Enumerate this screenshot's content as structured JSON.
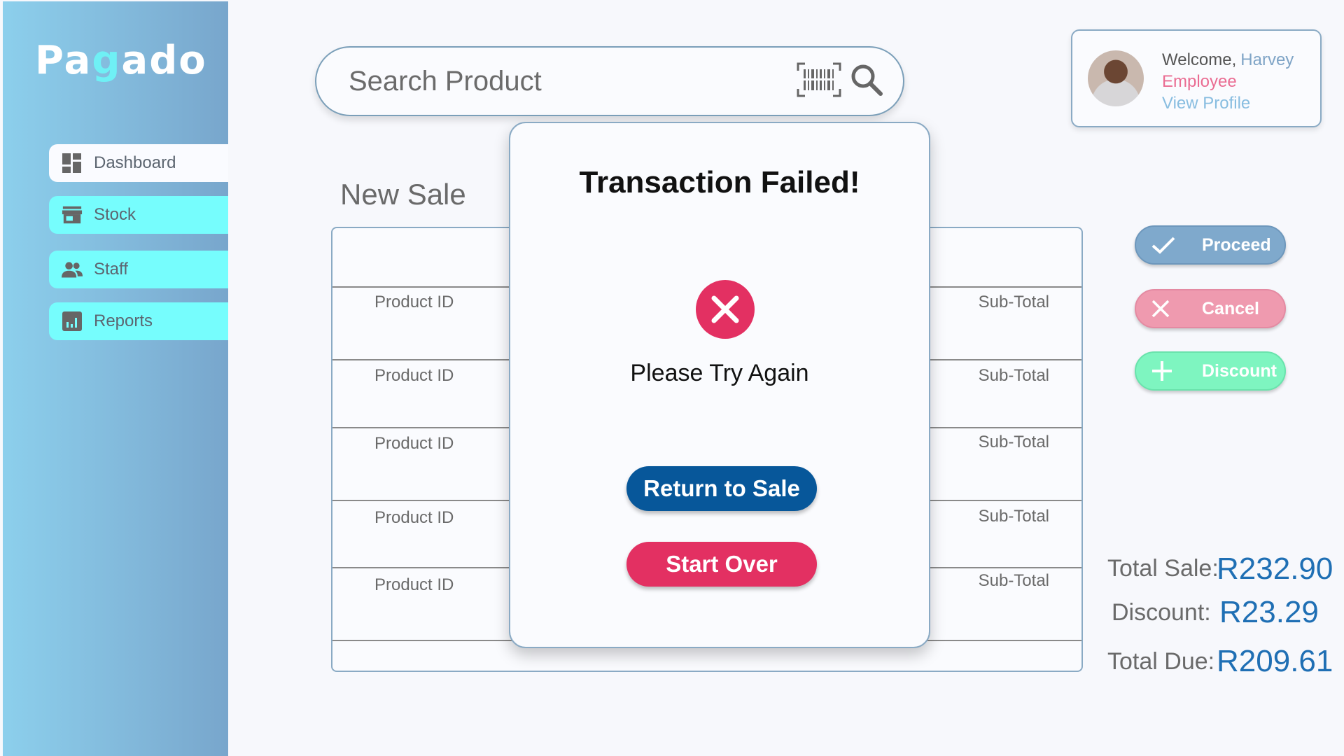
{
  "app": {
    "logo_pre": "Pa",
    "logo_g": "g",
    "logo_post": "ado"
  },
  "sidebar": {
    "items": [
      {
        "label": "Dashboard",
        "icon": "dashboard-icon"
      },
      {
        "label": "Stock",
        "icon": "store-icon"
      },
      {
        "label": "Staff",
        "icon": "people-icon"
      },
      {
        "label": "Reports",
        "icon": "bar-chart-icon"
      }
    ]
  },
  "search": {
    "placeholder": "Search Product"
  },
  "profile": {
    "welcome": "Welcome,",
    "name": "Harvey",
    "role": "Employee",
    "view_profile": "View Profile"
  },
  "sale": {
    "title": "New Sale",
    "rows": [
      {
        "product": "Product ID",
        "subtotal": "Sub-Total"
      },
      {
        "product": "Product ID",
        "subtotal": "Sub-Total"
      },
      {
        "product": "Product ID",
        "subtotal": "Sub-Total"
      },
      {
        "product": "Product ID",
        "subtotal": "Sub-Total"
      },
      {
        "product": "Product ID",
        "subtotal": "Sub-Total"
      }
    ]
  },
  "actions": {
    "proceed": "Proceed",
    "cancel": "Cancel",
    "discount": "Discount"
  },
  "totals": {
    "total_sale_label": "Total Sale:",
    "total_sale": "R232.90",
    "discount_label": "Discount:",
    "discount": "R23.29",
    "total_due_label": "Total Due:",
    "total_due": "R209.61"
  },
  "modal": {
    "title": "Transaction Failed!",
    "message": "Please Try Again",
    "return_label": "Return to Sale",
    "start_over_label": "Start Over"
  },
  "colors": {
    "accent_blue": "#07579a",
    "error_red": "#e33062",
    "proceed": "#7fa9cc",
    "cancel": "#ef9aaf",
    "discount": "#7ef5c0",
    "total_value": "#1f6fb4"
  }
}
